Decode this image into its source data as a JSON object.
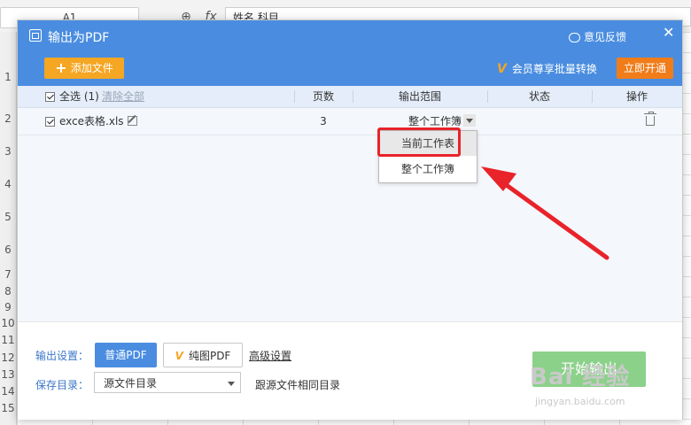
{
  "spreadsheet": {
    "cell_ref": "A1",
    "formula_text": "姓名      科目",
    "row_numbers": [
      "1",
      "2",
      "3",
      "4",
      "5",
      "6",
      "7",
      "8",
      "9",
      "10",
      "11",
      "12",
      "13",
      "14",
      "15"
    ]
  },
  "dialog": {
    "title": "输出为PDF",
    "feedback": "意见反馈",
    "close": "✕",
    "add_file": "添加文件",
    "vip_text": "会员尊享批量转换",
    "open_now": "立即开通",
    "table": {
      "select_all": "全选 (1)",
      "clear_all": "清除全部",
      "col_pages": "页数",
      "col_range": "输出范围",
      "col_status": "状态",
      "col_action": "操作",
      "rows": [
        {
          "filename": "exce表格.xls",
          "pages": "3",
          "range": "整个工作簿",
          "status": ""
        }
      ]
    },
    "range_menu": [
      "当前工作表",
      "整个工作簿"
    ],
    "footer": {
      "output_settings_label": "输出设置：",
      "normal_pdf": "普通PDF",
      "image_pdf": "纯图PDF",
      "advanced": "高级设置",
      "save_dir_label": "保存目录：",
      "save_dir_value": "源文件目录",
      "same_dir_text": "跟源文件相同目录",
      "start_button": "开始输出"
    }
  },
  "watermark": {
    "brand": "Bai  经验",
    "url": "jingyan.baidu.com"
  },
  "colors": {
    "titlebar": "#4a8de0",
    "orange": "#f5a623",
    "annotation_red": "#e8232a",
    "start_green": "#8bd18a"
  }
}
